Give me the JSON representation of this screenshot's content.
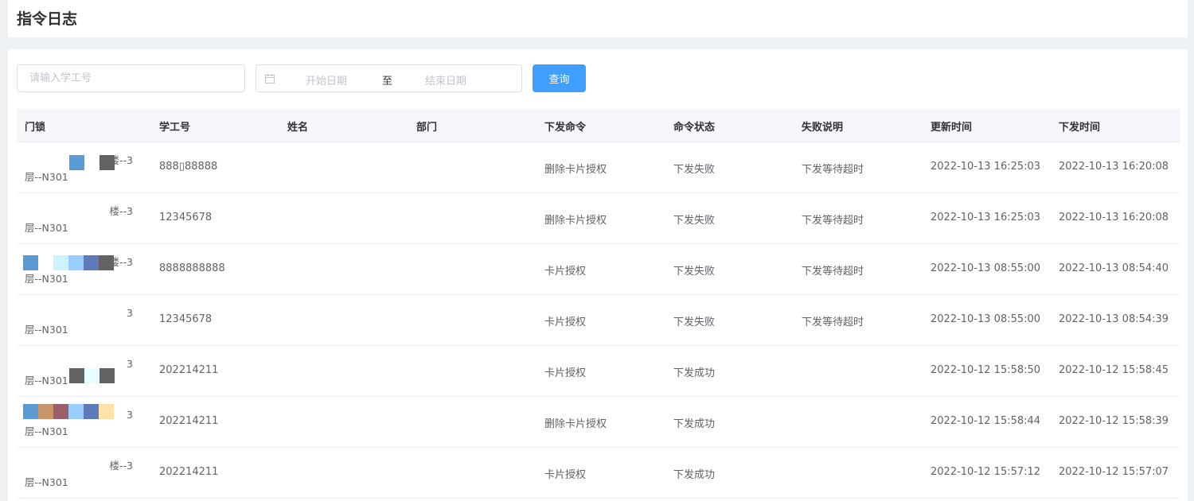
{
  "header": {
    "title": "指令日志"
  },
  "search": {
    "placeholder": "请输入学工号",
    "date_start_placeholder": "开始日期",
    "date_separator": "至",
    "date_end_placeholder": "结束日期",
    "query_label": "查询"
  },
  "colors": {
    "primary": "#409eff",
    "header_bg": "#f5f7fa",
    "page_bg": "#eef1f4"
  },
  "table": {
    "columns": [
      "门锁",
      "学工号",
      "姓名",
      "部门",
      "下发命令",
      "命令状态",
      "失败说明",
      "更新时间",
      "下发时间"
    ],
    "rows": [
      {
        "lock_line1": "楼--3",
        "lock_line2": "层--N301",
        "id": "888▯88888",
        "name": "",
        "dept": "",
        "command": "删除卡片授权",
        "status": "下发失败",
        "fail": "下发等待超时",
        "updated": "2022-10-13 16:25:03",
        "issued": "2022-10-13 16:20:08"
      },
      {
        "lock_line1": "楼--3",
        "lock_line2": "层--N301",
        "id": "12345678",
        "name": "",
        "dept": "",
        "command": "删除卡片授权",
        "status": "下发失败",
        "fail": "下发等待超时",
        "updated": "2022-10-13 16:25:03",
        "issued": "2022-10-13 16:20:08"
      },
      {
        "lock_line1": "楼--3",
        "lock_line2": "层--N301",
        "id": "8888888888",
        "name": "",
        "dept": "",
        "command": "卡片授权",
        "status": "下发失败",
        "fail": "下发等待超时",
        "updated": "2022-10-13 08:55:00",
        "issued": "2022-10-13 08:54:40"
      },
      {
        "lock_line1": "3",
        "lock_line2": "层--N301",
        "id": "12345678",
        "name": "",
        "dept": "",
        "command": "卡片授权",
        "status": "下发失败",
        "fail": "下发等待超时",
        "updated": "2022-10-13 08:55:00",
        "issued": "2022-10-13 08:54:39"
      },
      {
        "lock_line1": "3",
        "lock_line2": "层--N301",
        "id": "202214211",
        "name": "",
        "dept": "",
        "command": "卡片授权",
        "status": "下发成功",
        "fail": "",
        "updated": "2022-10-12 15:58:50",
        "issued": "2022-10-12 15:58:45"
      },
      {
        "lock_line1": "3",
        "lock_line2": "层--N301",
        "id": "202214211",
        "name": "",
        "dept": "",
        "command": "删除卡片授权",
        "status": "下发成功",
        "fail": "",
        "updated": "2022-10-12 15:58:44",
        "issued": "2022-10-12 15:58:39"
      },
      {
        "lock_line1": "楼--3",
        "lock_line2": "层--N301",
        "id": "202214211",
        "name": "",
        "dept": "",
        "command": "卡片授权",
        "status": "下发成功",
        "fail": "",
        "updated": "2022-10-12 15:57:12",
        "issued": "2022-10-12 15:57:07"
      }
    ]
  }
}
